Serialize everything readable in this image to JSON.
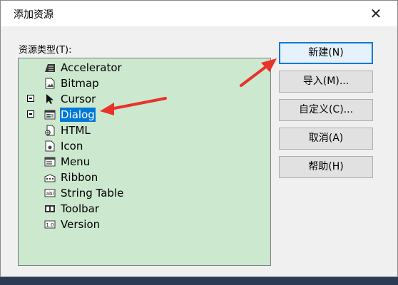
{
  "window": {
    "title": "添加资源",
    "close_glyph": "✕"
  },
  "resource_type_label": "资源类型(T):",
  "tree_items": [
    {
      "label": "Accelerator",
      "icon": "accelerator-icon",
      "expander": false,
      "selected": false
    },
    {
      "label": "Bitmap",
      "icon": "bitmap-icon",
      "expander": false,
      "selected": false
    },
    {
      "label": "Cursor",
      "icon": "cursor-icon",
      "expander": true,
      "selected": false
    },
    {
      "label": "Dialog",
      "icon": "dialog-icon",
      "expander": true,
      "selected": true
    },
    {
      "label": "HTML",
      "icon": "html-icon",
      "expander": false,
      "selected": false
    },
    {
      "label": "Icon",
      "icon": "icon-resource-icon",
      "expander": false,
      "selected": false
    },
    {
      "label": "Menu",
      "icon": "menu-icon",
      "expander": false,
      "selected": false
    },
    {
      "label": "Ribbon",
      "icon": "ribbon-icon",
      "expander": false,
      "selected": false
    },
    {
      "label": "String Table",
      "icon": "string-table-icon",
      "expander": false,
      "selected": false
    },
    {
      "label": "Toolbar",
      "icon": "toolbar-icon",
      "expander": false,
      "selected": false
    },
    {
      "label": "Version",
      "icon": "version-icon",
      "expander": false,
      "selected": false
    }
  ],
  "buttons": {
    "new": "新建(N)",
    "import": "导入(M)...",
    "custom": "自定义(C)...",
    "cancel": "取消(A)",
    "help": "帮助(H)"
  },
  "colors": {
    "tree_background": "#cce8cf",
    "selection": "#0078d7",
    "annotation_arrow": "#e8322a"
  }
}
